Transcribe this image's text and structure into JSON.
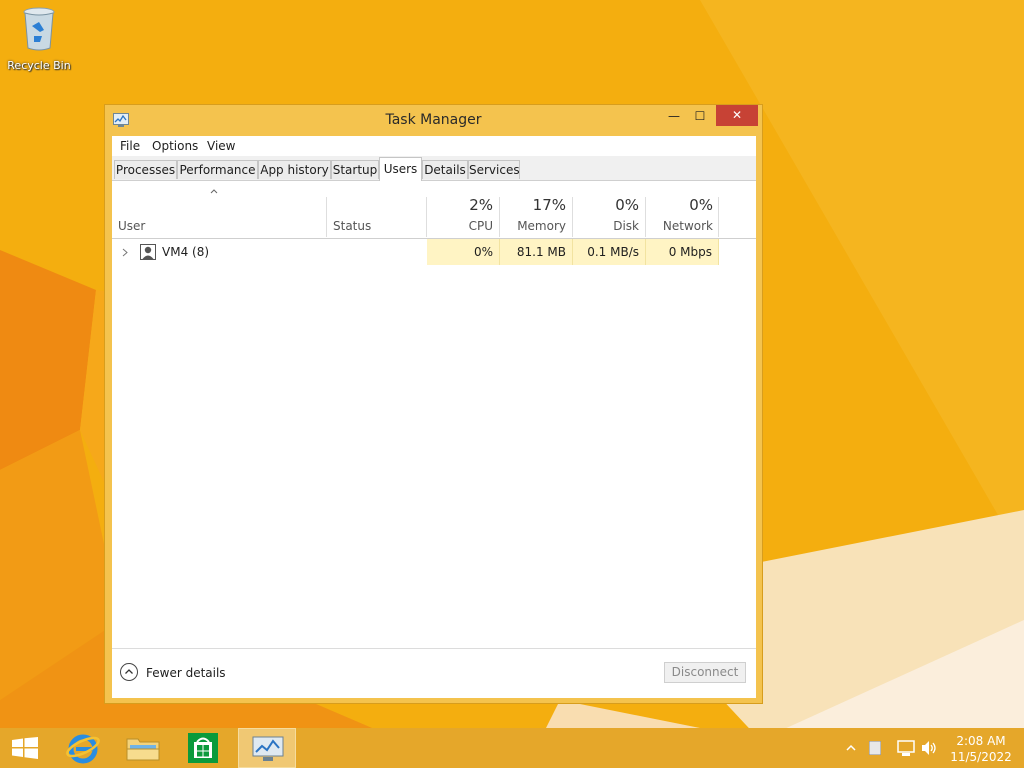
{
  "desktop": {
    "recycle_bin_label": "Recycle Bin"
  },
  "window": {
    "title": "Task Manager",
    "controls": {
      "minimize": "—",
      "maximize": "☐",
      "close": "✕"
    }
  },
  "menu": {
    "items": [
      "File",
      "Options",
      "View"
    ]
  },
  "tabs": {
    "items": [
      "Processes",
      "Performance",
      "App history",
      "Startup",
      "Users",
      "Details",
      "Services"
    ],
    "active": "Users"
  },
  "columns": {
    "user": {
      "label": "User"
    },
    "status": {
      "label": "Status"
    },
    "cpu": {
      "label": "CPU",
      "percent": "2%"
    },
    "memory": {
      "label": "Memory",
      "percent": "17%"
    },
    "disk": {
      "label": "Disk",
      "percent": "0%"
    },
    "network": {
      "label": "Network",
      "percent": "0%"
    }
  },
  "rows": [
    {
      "user": "VM4 (8)",
      "status": "",
      "cpu": "0%",
      "memory": "81.1 MB",
      "disk": "0.1 MB/s",
      "network": "0 Mbps"
    }
  ],
  "footer": {
    "fewer_details": "Fewer details",
    "disconnect": "Disconnect"
  },
  "taskbar": {
    "clock_time": "2:08 AM",
    "clock_date": "11/5/2022"
  },
  "colors": {
    "desktop": "#f3ae0b",
    "window_frame": "#f4c34e",
    "close_button": "#c74235",
    "heat_cell": "#fff4c4",
    "taskbar": "#e5a72a"
  }
}
